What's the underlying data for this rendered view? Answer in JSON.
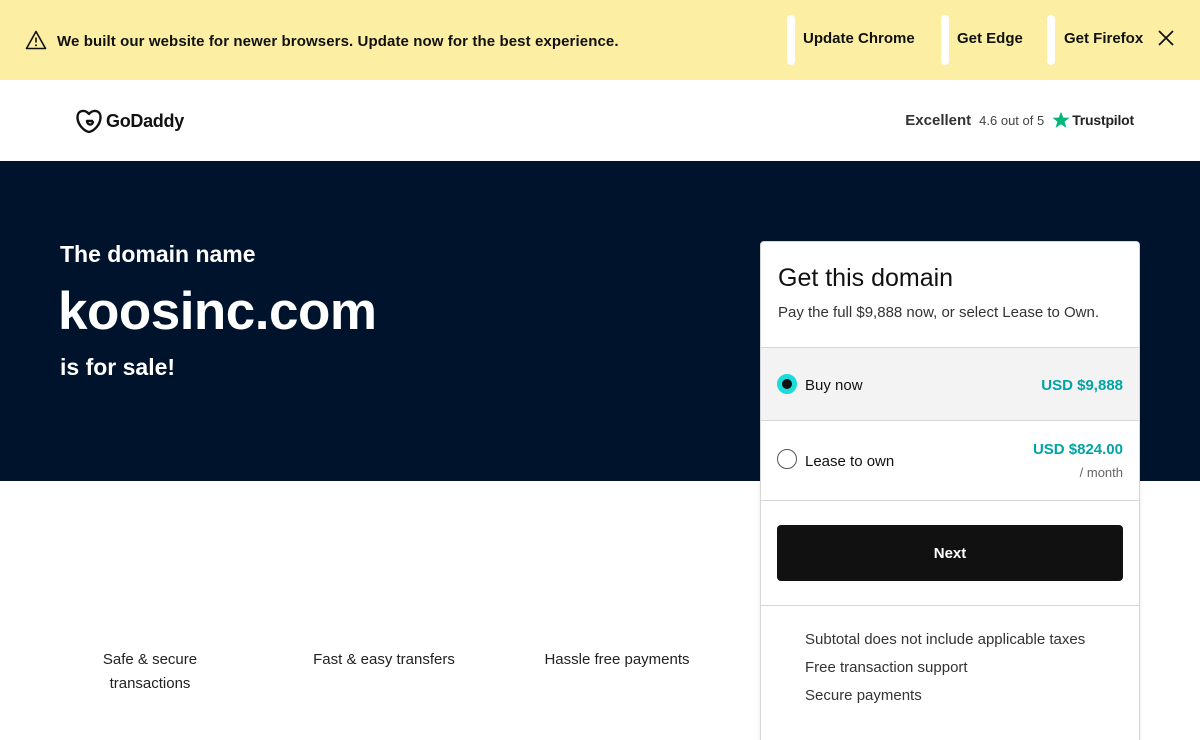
{
  "banner": {
    "message": "We built our website for newer browsers. Update now for the best experience.",
    "links": [
      "Update Chrome",
      "Get Edge",
      "Get Firefox"
    ],
    "icons": {
      "warning": "warning-triangle-icon",
      "close": "close-icon"
    }
  },
  "header": {
    "logo_text": "GoDaddy",
    "trustpilot": {
      "rating_word": "Excellent",
      "score": "4.6 out of 5",
      "brand": "Trustpilot",
      "star_color": "#00b67a"
    }
  },
  "hero": {
    "pre_title": "The domain name",
    "domain": "koosinc.com",
    "post_title": "is for sale!",
    "background": "#00132d"
  },
  "features": [
    "Safe & secure transactions",
    "Fast & easy transfers",
    "Hassle free payments"
  ],
  "purchase_card": {
    "title": "Get this domain",
    "subtitle": "Pay the full $9,888 now, or select Lease to Own.",
    "options": [
      {
        "label": "Buy now",
        "price": "USD $9,888",
        "selected": true
      },
      {
        "label": "Lease to own",
        "price": "USD $824.00",
        "unit": "/ month",
        "selected": false
      }
    ],
    "next_label": "Next",
    "info": [
      "Subtotal does not include applicable taxes",
      "Free transaction support",
      "Secure payments"
    ],
    "accent_color": "#00a4a6"
  }
}
